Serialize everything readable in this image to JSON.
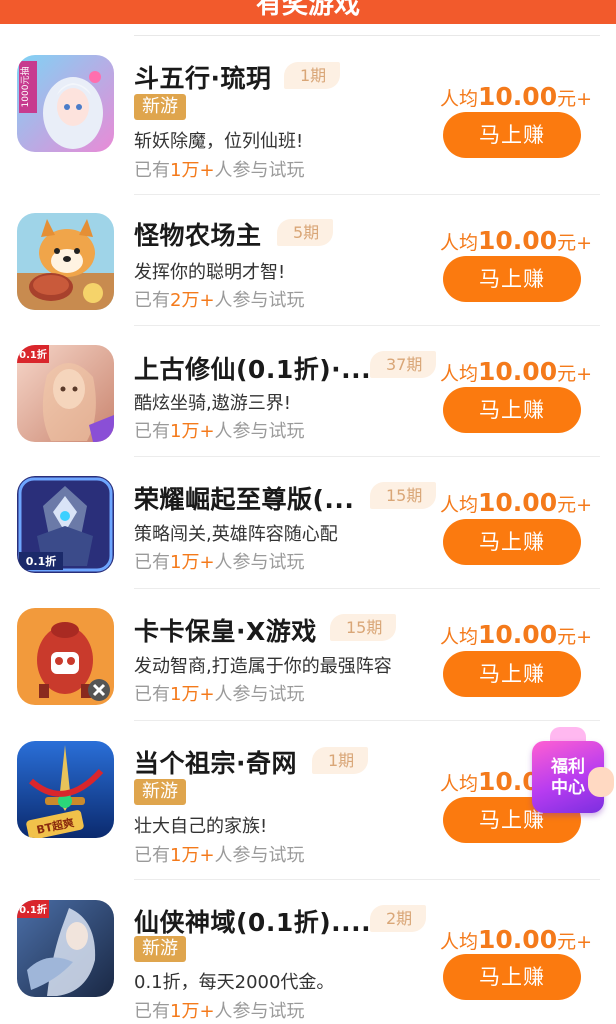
{
  "header": {
    "title": "有奖游戏"
  },
  "games": [
    {
      "name": "斗五行·琉玥",
      "period": "1期",
      "is_new": true,
      "new_label": "新游",
      "desc": "斩妖除魔，位列仙班!",
      "players_prefix": "已有",
      "players_count": "1万+",
      "players_suffix": "人参与试玩",
      "reward_label": "人均",
      "reward_amount": "10.00",
      "reward_suffix": "元+",
      "button": "马上赚",
      "icon": "anime-girl-icon"
    },
    {
      "name": "怪物农场主",
      "period": "5期",
      "is_new": false,
      "desc": "发挥你的聪明才智!",
      "players_prefix": "已有",
      "players_count": "2万+",
      "players_suffix": "人参与试玩",
      "reward_label": "人均",
      "reward_amount": "10.00",
      "reward_suffix": "元+",
      "button": "马上赚",
      "icon": "shiba-dog-icon"
    },
    {
      "name": "上古修仙(0.1折)·...",
      "period": "37期",
      "is_new": false,
      "desc": "酷炫坐骑,遨游三界!",
      "players_prefix": "已有",
      "players_count": "1万+",
      "players_suffix": "人参与试玩",
      "reward_label": "人均",
      "reward_amount": "10.00",
      "reward_suffix": "元+",
      "button": "马上赚",
      "icon": "fairy-icon"
    },
    {
      "name": "荣耀崛起至尊版(...",
      "period": "15期",
      "is_new": false,
      "desc": "策略闯关,英雄阵容随心配",
      "players_prefix": "已有",
      "players_count": "1万+",
      "players_suffix": "人参与试玩",
      "reward_label": "人均",
      "reward_amount": "10.00",
      "reward_suffix": "元+",
      "button": "马上赚",
      "icon": "armored-knight-icon"
    },
    {
      "name": "卡卡保皇·X游戏",
      "period": "15期",
      "is_new": false,
      "desc": "发动智商,打造属于你的最强阵容",
      "players_prefix": "已有",
      "players_count": "1万+",
      "players_suffix": "人参与试玩",
      "reward_label": "人均",
      "reward_amount": "10.00",
      "reward_suffix": "元+",
      "button": "马上赚",
      "icon": "skull-pod-icon"
    },
    {
      "name": "当个祖宗·奇网",
      "period": "1期",
      "is_new": true,
      "new_label": "新游",
      "desc": "壮大自己的家族!",
      "players_prefix": "已有",
      "players_count": "1万+",
      "players_suffix": "人参与试玩",
      "reward_label": "人均",
      "reward_amount": "10.0",
      "reward_suffix": "",
      "button": "马上赚",
      "icon": "sword-icon"
    },
    {
      "name": "仙侠神域(0.1折)....",
      "period": "2期",
      "is_new": true,
      "new_label": "新游",
      "desc": "0.1折，每天2000代金。",
      "players_prefix": "已有",
      "players_count": "1万+",
      "players_suffix": "人参与试玩",
      "reward_label": "人均",
      "reward_amount": "10.00",
      "reward_suffix": "元+",
      "button": "马上赚",
      "icon": "swordsman-icon"
    }
  ],
  "icon_labels": {
    "g0": "1000元抽",
    "g2": "0.1折",
    "g3": "0.1折",
    "g5": "BT超爽",
    "g6": "0.1折"
  },
  "welfare": {
    "line1": "福利",
    "line2": "中心"
  },
  "colors": {
    "accent": "#fb7a0f",
    "header": "#f25a2c",
    "new_badge": "#dfa54d"
  }
}
